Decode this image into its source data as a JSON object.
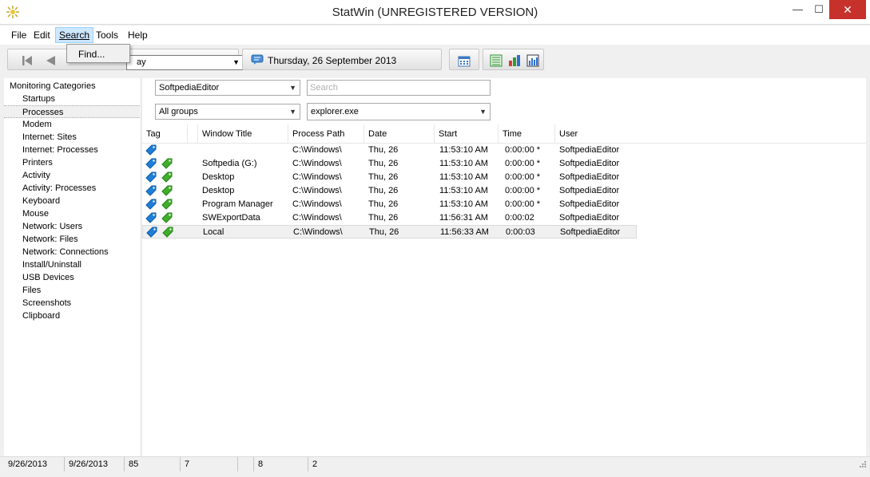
{
  "window": {
    "title": "StatWin (UNREGISTERED VERSION)",
    "min": "—",
    "max": "☐",
    "close": "✕"
  },
  "menu": {
    "file": "File",
    "edit": "Edit",
    "search": "Search",
    "tools": "Tools",
    "help": "Help"
  },
  "dropdown": {
    "find": "Find..."
  },
  "toolbar": {
    "period_value": "ay",
    "date_label": "Thursday, 26 September 2013"
  },
  "sidebar": {
    "title": "Monitoring Categories",
    "items": [
      "Startups",
      "Processes",
      "Modem",
      "Internet: Sites",
      "Internet: Processes",
      "Printers",
      "Activity",
      "Activity: Processes",
      "Keyboard",
      "Mouse",
      "Network: Users",
      "Network: Files",
      "Network: Connections",
      "Install/Uninstall",
      "USB Devices",
      "Files",
      "Screenshots",
      "Clipboard"
    ],
    "selected": "Processes"
  },
  "filters": {
    "user": "SoftpediaEditor",
    "group": "All groups",
    "search_placeholder": "Search",
    "process": "explorer.exe"
  },
  "table": {
    "headers": {
      "tag": "Tag",
      "window": "Window Title",
      "path": "Process Path",
      "date": "Date",
      "start": "Start",
      "time": "Time",
      "user": "User"
    },
    "rows": [
      {
        "window": "",
        "path": "C:\\Windows\\",
        "date": "Thu, 26",
        "start": "11:53:10 AM",
        "time": "0:00:00 *",
        "user": "SoftpediaEditor"
      },
      {
        "window": "Softpedia (G:)",
        "path": "C:\\Windows\\",
        "date": "Thu, 26",
        "start": "11:53:10 AM",
        "time": "0:00:00 *",
        "user": "SoftpediaEditor"
      },
      {
        "window": "Desktop",
        "path": "C:\\Windows\\",
        "date": "Thu, 26",
        "start": "11:53:10 AM",
        "time": "0:00:00 *",
        "user": "SoftpediaEditor"
      },
      {
        "window": "Desktop",
        "path": "C:\\Windows\\",
        "date": "Thu, 26",
        "start": "11:53:10 AM",
        "time": "0:00:00 *",
        "user": "SoftpediaEditor"
      },
      {
        "window": "Program Manager",
        "path": "C:\\Windows\\",
        "date": "Thu, 26",
        "start": "11:53:10 AM",
        "time": "0:00:00 *",
        "user": "SoftpediaEditor"
      },
      {
        "window": "SWExportData",
        "path": "C:\\Windows\\",
        "date": "Thu, 26",
        "start": "11:56:31 AM",
        "time": "0:00:02",
        "user": "SoftpediaEditor"
      },
      {
        "window": "Local",
        "path": "C:\\Windows\\",
        "date": "Thu, 26",
        "start": "11:56:33 AM",
        "time": "0:00:03",
        "user": "SoftpediaEditor"
      }
    ]
  },
  "status": {
    "from": "9/26/2013",
    "to": "9/26/2013",
    "c1": "85",
    "c2": "7",
    "c3": "",
    "c4": "8",
    "c5": "2"
  },
  "colors": {
    "close_red": "#c7312b",
    "menu_highlight": "#cde8ff",
    "tag_blue": "#1e7fd8",
    "tag_green": "#3fae2a"
  }
}
